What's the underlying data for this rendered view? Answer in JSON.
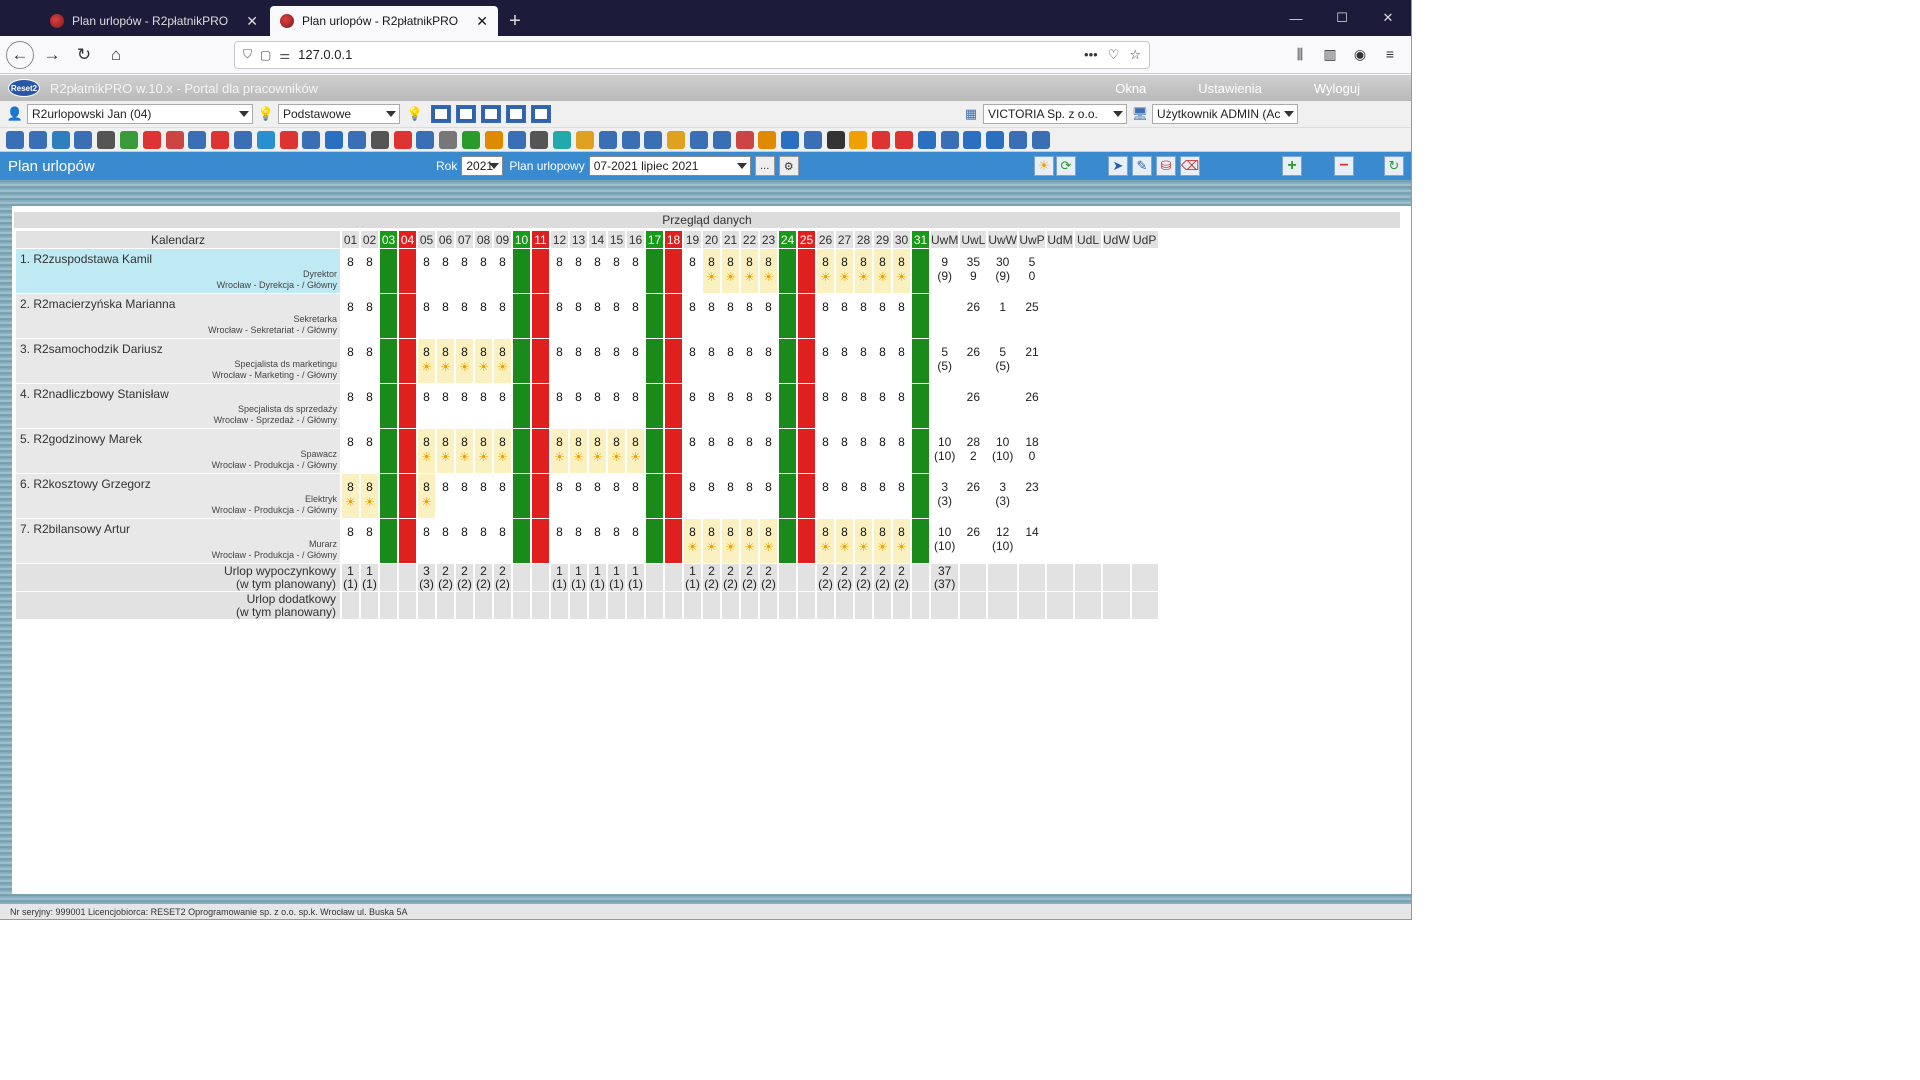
{
  "browser": {
    "tabs": [
      {
        "title": "Plan urlopów - R2płatnikPRO",
        "active": false
      },
      {
        "title": "Plan urlopów - R2płatnikPRO",
        "active": true
      }
    ],
    "url": "127.0.0.1"
  },
  "app": {
    "logo_text": "Reset2",
    "title": "R2płatnikPRO w.10.x - Portal dla pracowników",
    "menu": [
      "Okna",
      "Ustawienia",
      "Wyloguj"
    ],
    "employee_select": "R2urlopowski Jan (04)",
    "mode_select": "Podstawowe",
    "company_select": "VICTORIA Sp. z o.o.",
    "user_select": "Użytkownik ADMIN (Ac"
  },
  "toolbar": {
    "icon_colors": [
      "#3b6fb5",
      "#3b6fb5",
      "#2f7fbf",
      "#3b6fb5",
      "#555",
      "#3a9a3a",
      "#d33",
      "#c44",
      "#3b6fb5",
      "#d33",
      "#3b6fb5",
      "#2a8fd0",
      "#d33",
      "#3b6fb5",
      "#2a6fc0",
      "#3b6fb5",
      "#555",
      "#d33",
      "#3b6fb5",
      "#777",
      "#2a9a2a",
      "#e08a00",
      "#3b6fb5",
      "#555",
      "#2aa",
      "#e0a020",
      "#3b6fb5",
      "#3b6fb5",
      "#3b6fb5",
      "#e0a020",
      "#3b6fb5",
      "#3b6fb5",
      "#c44",
      "#e08a00",
      "#2a6fc0",
      "#3b6fb5",
      "#333",
      "#f0a000",
      "#d33",
      "#d33",
      "#2a6fc0",
      "#3b6fb5",
      "#2a6fc0",
      "#2a6fc0",
      "#3b6fb5",
      "#3b6fb5"
    ]
  },
  "section": {
    "title": "Plan urlopów",
    "year_label": "Rok",
    "year_value": "2021",
    "plan_label": "Plan urlopowy",
    "plan_value": "07-2021 lipiec 2021",
    "ellipsis_label": "..."
  },
  "table": {
    "header_title": "Przegląd danych",
    "calendar_label": "Kalendarz",
    "days": [
      "01",
      "02",
      "03",
      "04",
      "05",
      "06",
      "07",
      "08",
      "09",
      "10",
      "11",
      "12",
      "13",
      "14",
      "15",
      "16",
      "17",
      "18",
      "19",
      "20",
      "21",
      "22",
      "23",
      "24",
      "25",
      "26",
      "27",
      "28",
      "29",
      "30",
      "31"
    ],
    "saturdays": [
      "03",
      "10",
      "17",
      "24",
      "31"
    ],
    "sundays": [
      "04",
      "11",
      "18",
      "25"
    ],
    "summary_headers": [
      "UwM",
      "UwL",
      "UwW",
      "UwP",
      "UdM",
      "UdL",
      "UdW",
      "UdP"
    ],
    "employees": [
      {
        "name": "1. R2zuspodstawa Kamil",
        "position": "Dyrektor",
        "dept": "Wrocław - Dyrekcja - / Główny",
        "highlighted": true,
        "vacation_days": [
          "20",
          "21",
          "22",
          "23",
          "26",
          "27",
          "28",
          "29",
          "30"
        ],
        "summary": [
          "9\n(9)",
          "35\n9",
          "30\n(9)",
          "5\n0",
          "",
          "",
          "",
          ""
        ]
      },
      {
        "name": "2. R2macierzyńska Marianna",
        "position": "Sekretarka",
        "dept": "Wrocław - Sekretariat - / Główny",
        "highlighted": false,
        "vacation_days": [],
        "summary": [
          "",
          "26",
          "1",
          "25",
          "",
          "",
          "",
          ""
        ]
      },
      {
        "name": "3. R2samochodzik Dariusz",
        "position": "Specjalista ds marketingu",
        "dept": "Wrocław - Marketing - / Główny",
        "highlighted": false,
        "vacation_days": [
          "05",
          "06",
          "07",
          "08",
          "09"
        ],
        "summary": [
          "5\n(5)",
          "26",
          "5\n(5)",
          "21",
          "",
          "",
          "",
          ""
        ]
      },
      {
        "name": "4. R2nadliczbowy Stanisław",
        "position": "Specjalista ds sprzedaży",
        "dept": "Wrocław - Sprzedaż - / Główny",
        "highlighted": false,
        "vacation_days": [],
        "summary": [
          "",
          "26",
          "",
          "26",
          "",
          "",
          "",
          ""
        ]
      },
      {
        "name": "5. R2godzinowy Marek",
        "position": "Spawacz",
        "dept": "Wrocław - Produkcja - / Główny",
        "highlighted": false,
        "vacation_days": [
          "05",
          "06",
          "07",
          "08",
          "09",
          "12",
          "13",
          "14",
          "15",
          "16"
        ],
        "summary": [
          "10\n(10)",
          "28\n2",
          "10\n(10)",
          "18\n0",
          "",
          "",
          "",
          ""
        ]
      },
      {
        "name": "6. R2kosztowy Grzegorz",
        "position": "Elektryk",
        "dept": "Wrocław - Produkcja - / Główny",
        "highlighted": false,
        "vacation_days": [
          "01",
          "02",
          "05"
        ],
        "summary": [
          "3\n(3)",
          "26",
          "3\n(3)",
          "23",
          "",
          "",
          "",
          ""
        ]
      },
      {
        "name": "7. R2bilansowy Artur",
        "position": "Murarz",
        "dept": "Wrocław - Produkcja - / Główny",
        "highlighted": false,
        "vacation_days": [
          "19",
          "20",
          "21",
          "22",
          "23",
          "26",
          "27",
          "28",
          "29",
          "30"
        ],
        "summary": [
          "10\n(10)",
          "26",
          "12\n(10)",
          "14",
          "",
          "",
          "",
          ""
        ]
      }
    ],
    "work_hours": "8",
    "totals": [
      {
        "label_line1": "Urlop wypoczynkowy",
        "label_line2": "(w tym planowany)",
        "days": {
          "01": "1\n(1)",
          "02": "1\n(1)",
          "05": "3\n(3)",
          "06": "2\n(2)",
          "07": "2\n(2)",
          "08": "2\n(2)",
          "09": "2\n(2)",
          "12": "1\n(1)",
          "13": "1\n(1)",
          "14": "1\n(1)",
          "15": "1\n(1)",
          "16": "1\n(1)",
          "19": "1\n(1)",
          "20": "2\n(2)",
          "21": "2\n(2)",
          "22": "2\n(2)",
          "23": "2\n(2)",
          "26": "2\n(2)",
          "27": "2\n(2)",
          "28": "2\n(2)",
          "29": "2\n(2)",
          "30": "2\n(2)"
        },
        "summary": [
          "37\n(37)",
          "",
          "",
          "",
          "",
          "",
          "",
          ""
        ]
      },
      {
        "label_line1": "Urlop dodatkowy",
        "label_line2": "(w tym planowany)",
        "days": {},
        "summary": [
          "",
          "",
          "",
          "",
          "",
          "",
          "",
          ""
        ]
      }
    ]
  },
  "status_bar": "Nr seryjny: 999001 Licencjobiorca: RESET2 Oprogramowanie sp. z o.o. sp.k. Wrocław ul. Buska 5A"
}
